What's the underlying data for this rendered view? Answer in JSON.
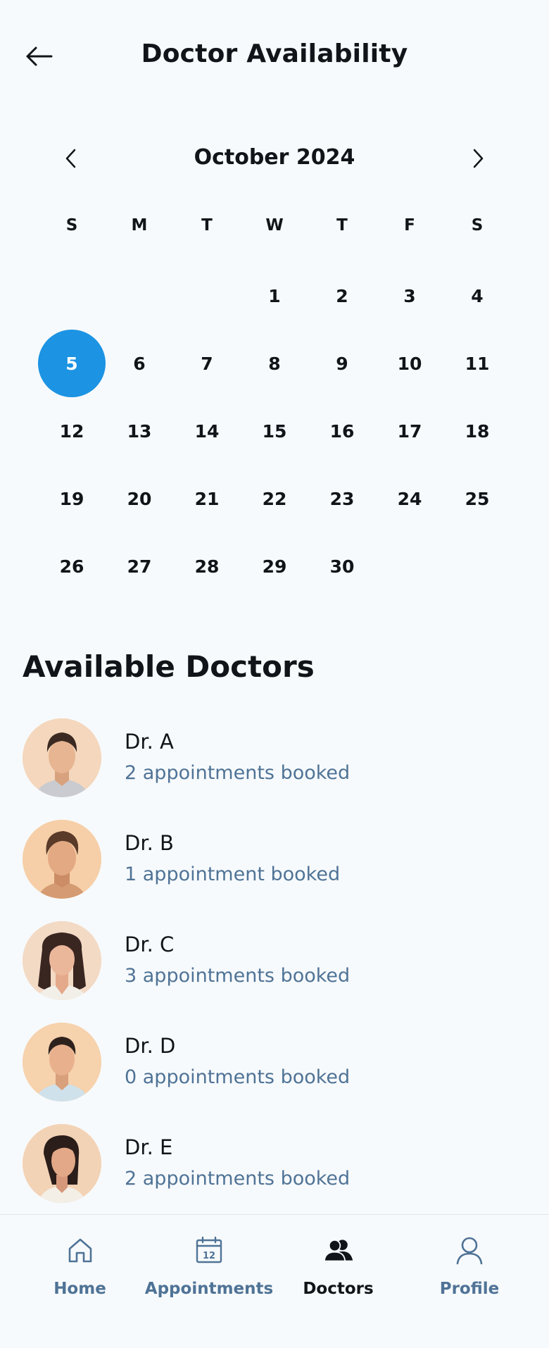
{
  "header": {
    "title": "Doctor Availability"
  },
  "calendar": {
    "month_label": "October 2024",
    "weekdays": [
      "S",
      "M",
      "T",
      "W",
      "T",
      "F",
      "S"
    ],
    "leading_blanks": 3,
    "days": [
      "1",
      "2",
      "3",
      "4",
      "5",
      "6",
      "7",
      "8",
      "9",
      "10",
      "11",
      "12",
      "13",
      "14",
      "15",
      "16",
      "17",
      "18",
      "19",
      "20",
      "21",
      "22",
      "23",
      "24",
      "25",
      "26",
      "27",
      "28",
      "29",
      "30"
    ],
    "selected_day": "5",
    "accent_color": "#1c93e3"
  },
  "doctors_section": {
    "title": "Available Doctors",
    "doctors": [
      {
        "name": "Dr. A",
        "booked": "2 appointments booked",
        "avatar": "male-doctor-avatar"
      },
      {
        "name": "Dr. B",
        "booked": "1 appointment booked",
        "avatar": "male-doctor-avatar"
      },
      {
        "name": "Dr. C",
        "booked": "3 appointments booked",
        "avatar": "female-doctor-avatar"
      },
      {
        "name": "Dr. D",
        "booked": "0 appointments booked",
        "avatar": "male-doctor-avatar"
      },
      {
        "name": "Dr. E",
        "booked": "2 appointments booked",
        "avatar": "female-doctor-avatar"
      }
    ]
  },
  "bottom_nav": {
    "items": [
      {
        "label": "Home",
        "icon": "home-icon",
        "active": false
      },
      {
        "label": "Appointments",
        "icon": "calendar-icon",
        "active": false,
        "icon_text": "12"
      },
      {
        "label": "Doctors",
        "icon": "users-icon",
        "active": true
      },
      {
        "label": "Profile",
        "icon": "user-icon",
        "active": false
      }
    ]
  },
  "colors": {
    "background": "#f7fafc",
    "text": "#111418",
    "muted": "#4f7396",
    "accent": "#1c93e3"
  }
}
